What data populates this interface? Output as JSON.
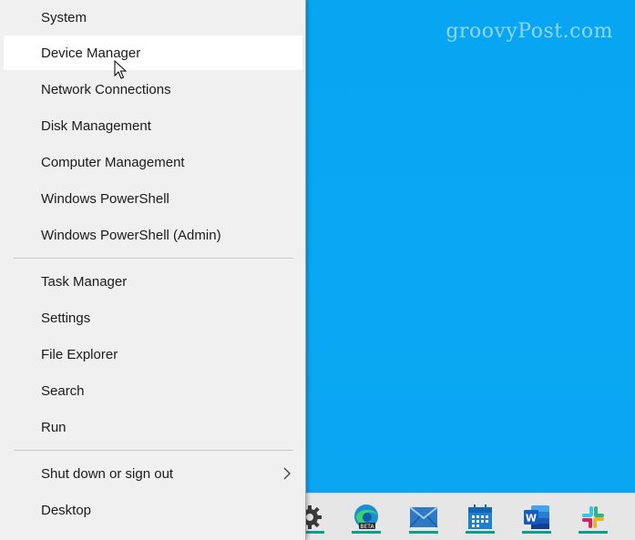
{
  "watermark": "groovyPost.com",
  "menu": {
    "items": [
      {
        "label": "System"
      },
      {
        "label": "Device Manager"
      },
      {
        "label": "Network Connections"
      },
      {
        "label": "Disk Management"
      },
      {
        "label": "Computer Management"
      },
      {
        "label": "Windows PowerShell"
      },
      {
        "label": "Windows PowerShell (Admin)"
      },
      {
        "label": "Task Manager"
      },
      {
        "label": "Settings"
      },
      {
        "label": "File Explorer"
      },
      {
        "label": "Search"
      },
      {
        "label": "Run"
      },
      {
        "label": "Shut down or sign out"
      },
      {
        "label": "Desktop"
      }
    ],
    "hovered_item": "Device Manager"
  },
  "taskbar": {
    "icons": [
      {
        "name": "settings-gear-icon"
      },
      {
        "name": "edge-beta-icon",
        "badge": "BETA"
      },
      {
        "name": "mail-icon"
      },
      {
        "name": "calendar-icon"
      },
      {
        "name": "word-icon",
        "letter": "W"
      },
      {
        "name": "slack-icon"
      }
    ]
  },
  "colors": {
    "desktop_blue": "#0aa8f4",
    "menu_bg": "#f0f0f0",
    "hover_bg": "#ffffff",
    "taskbar_accent": "#0f9e8a"
  }
}
